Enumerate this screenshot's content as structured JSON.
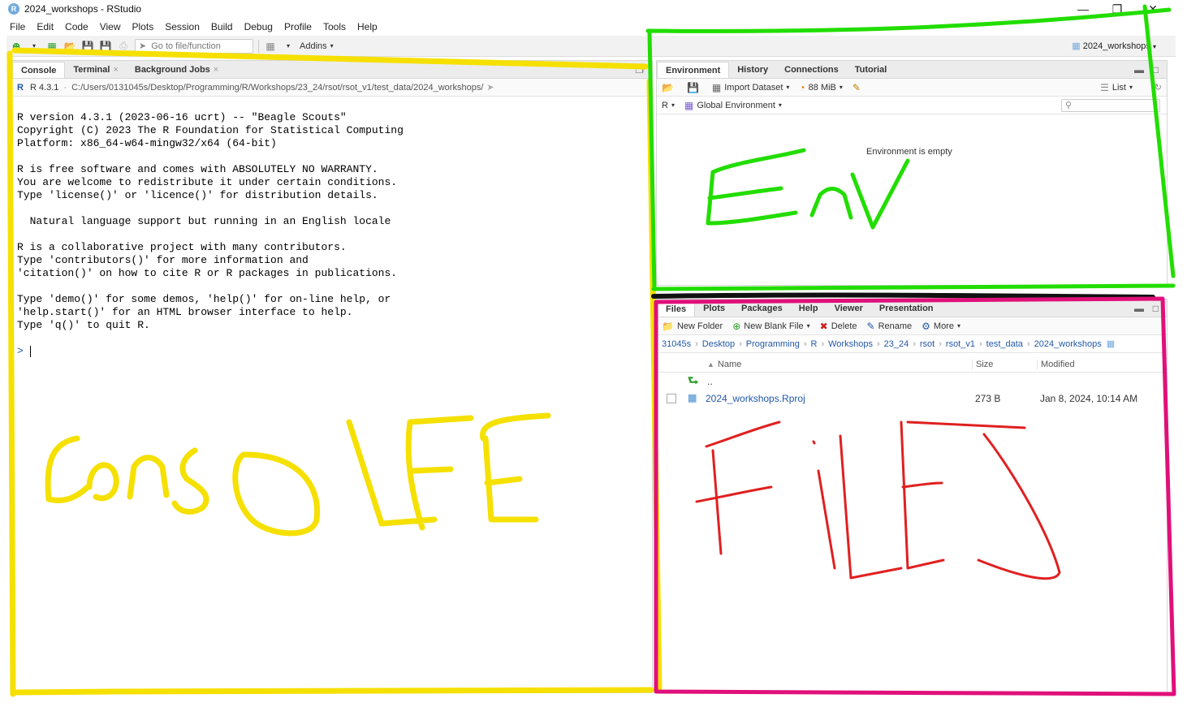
{
  "window": {
    "title": "2024_workshops - RStudio",
    "app_icon_letter": "R"
  },
  "menu": [
    "File",
    "Edit",
    "Code",
    "View",
    "Plots",
    "Session",
    "Build",
    "Debug",
    "Profile",
    "Tools",
    "Help"
  ],
  "toolbar": {
    "goto_placeholder": "Go to file/function",
    "addins_label": "Addins",
    "project": "2024_workshops"
  },
  "console_pane": {
    "tabs": [
      "Console",
      "Terminal",
      "Background Jobs"
    ],
    "r_version": "R 4.3.1",
    "path": "C:/Users/0131045s/Desktop/Programming/R/Workshops/23_24/rsot/rsot_v1/test_data/2024_workshops/",
    "startup_text": "R version 4.3.1 (2023-06-16 ucrt) -- \"Beagle Scouts\"\nCopyright (C) 2023 The R Foundation for Statistical Computing\nPlatform: x86_64-w64-mingw32/x64 (64-bit)\n\nR is free software and comes with ABSOLUTELY NO WARRANTY.\nYou are welcome to redistribute it under certain conditions.\nType 'license()' or 'licence()' for distribution details.\n\n  Natural language support but running in an English locale\n\nR is a collaborative project with many contributors.\nType 'contributors()' for more information and\n'citation()' on how to cite R or R packages in publications.\n\nType 'demo()' for some demos, 'help()' for on-line help, or\n'help.start()' for an HTML browser interface to help.\nType 'q()' to quit R.",
    "prompt": "> "
  },
  "env_pane": {
    "tabs": [
      "Environment",
      "History",
      "Connections",
      "Tutorial"
    ],
    "import_label": "Import Dataset",
    "memory": "88 MiB",
    "list_label": "List",
    "lang_label": "R",
    "scope_label": "Global Environment",
    "empty_message": "Environment is empty"
  },
  "files_pane": {
    "tabs": [
      "Files",
      "Plots",
      "Packages",
      "Help",
      "Viewer",
      "Presentation"
    ],
    "actions": {
      "new_folder": "New Folder",
      "new_blank_file": "New Blank File",
      "delete": "Delete",
      "rename": "Rename",
      "more": "More"
    },
    "breadcrumb": [
      "31045s",
      "Desktop",
      "Programming",
      "R",
      "Workshops",
      "23_24",
      "rsot",
      "rsot_v1",
      "test_data",
      "2024_workshops"
    ],
    "columns": {
      "name": "Name",
      "size": "Size",
      "modified": "Modified"
    },
    "parent_row": "..",
    "rows": [
      {
        "name": "2024_workshops.Rproj",
        "size": "273 B",
        "modified": "Jan 8, 2024, 10:14 AM"
      }
    ]
  },
  "annotations": {
    "console_color": "#f5e000",
    "env_color": "#22dd00",
    "files_frame_color": "#e0107a",
    "files_text_color": "#e02020",
    "divider_color": "#111111"
  }
}
